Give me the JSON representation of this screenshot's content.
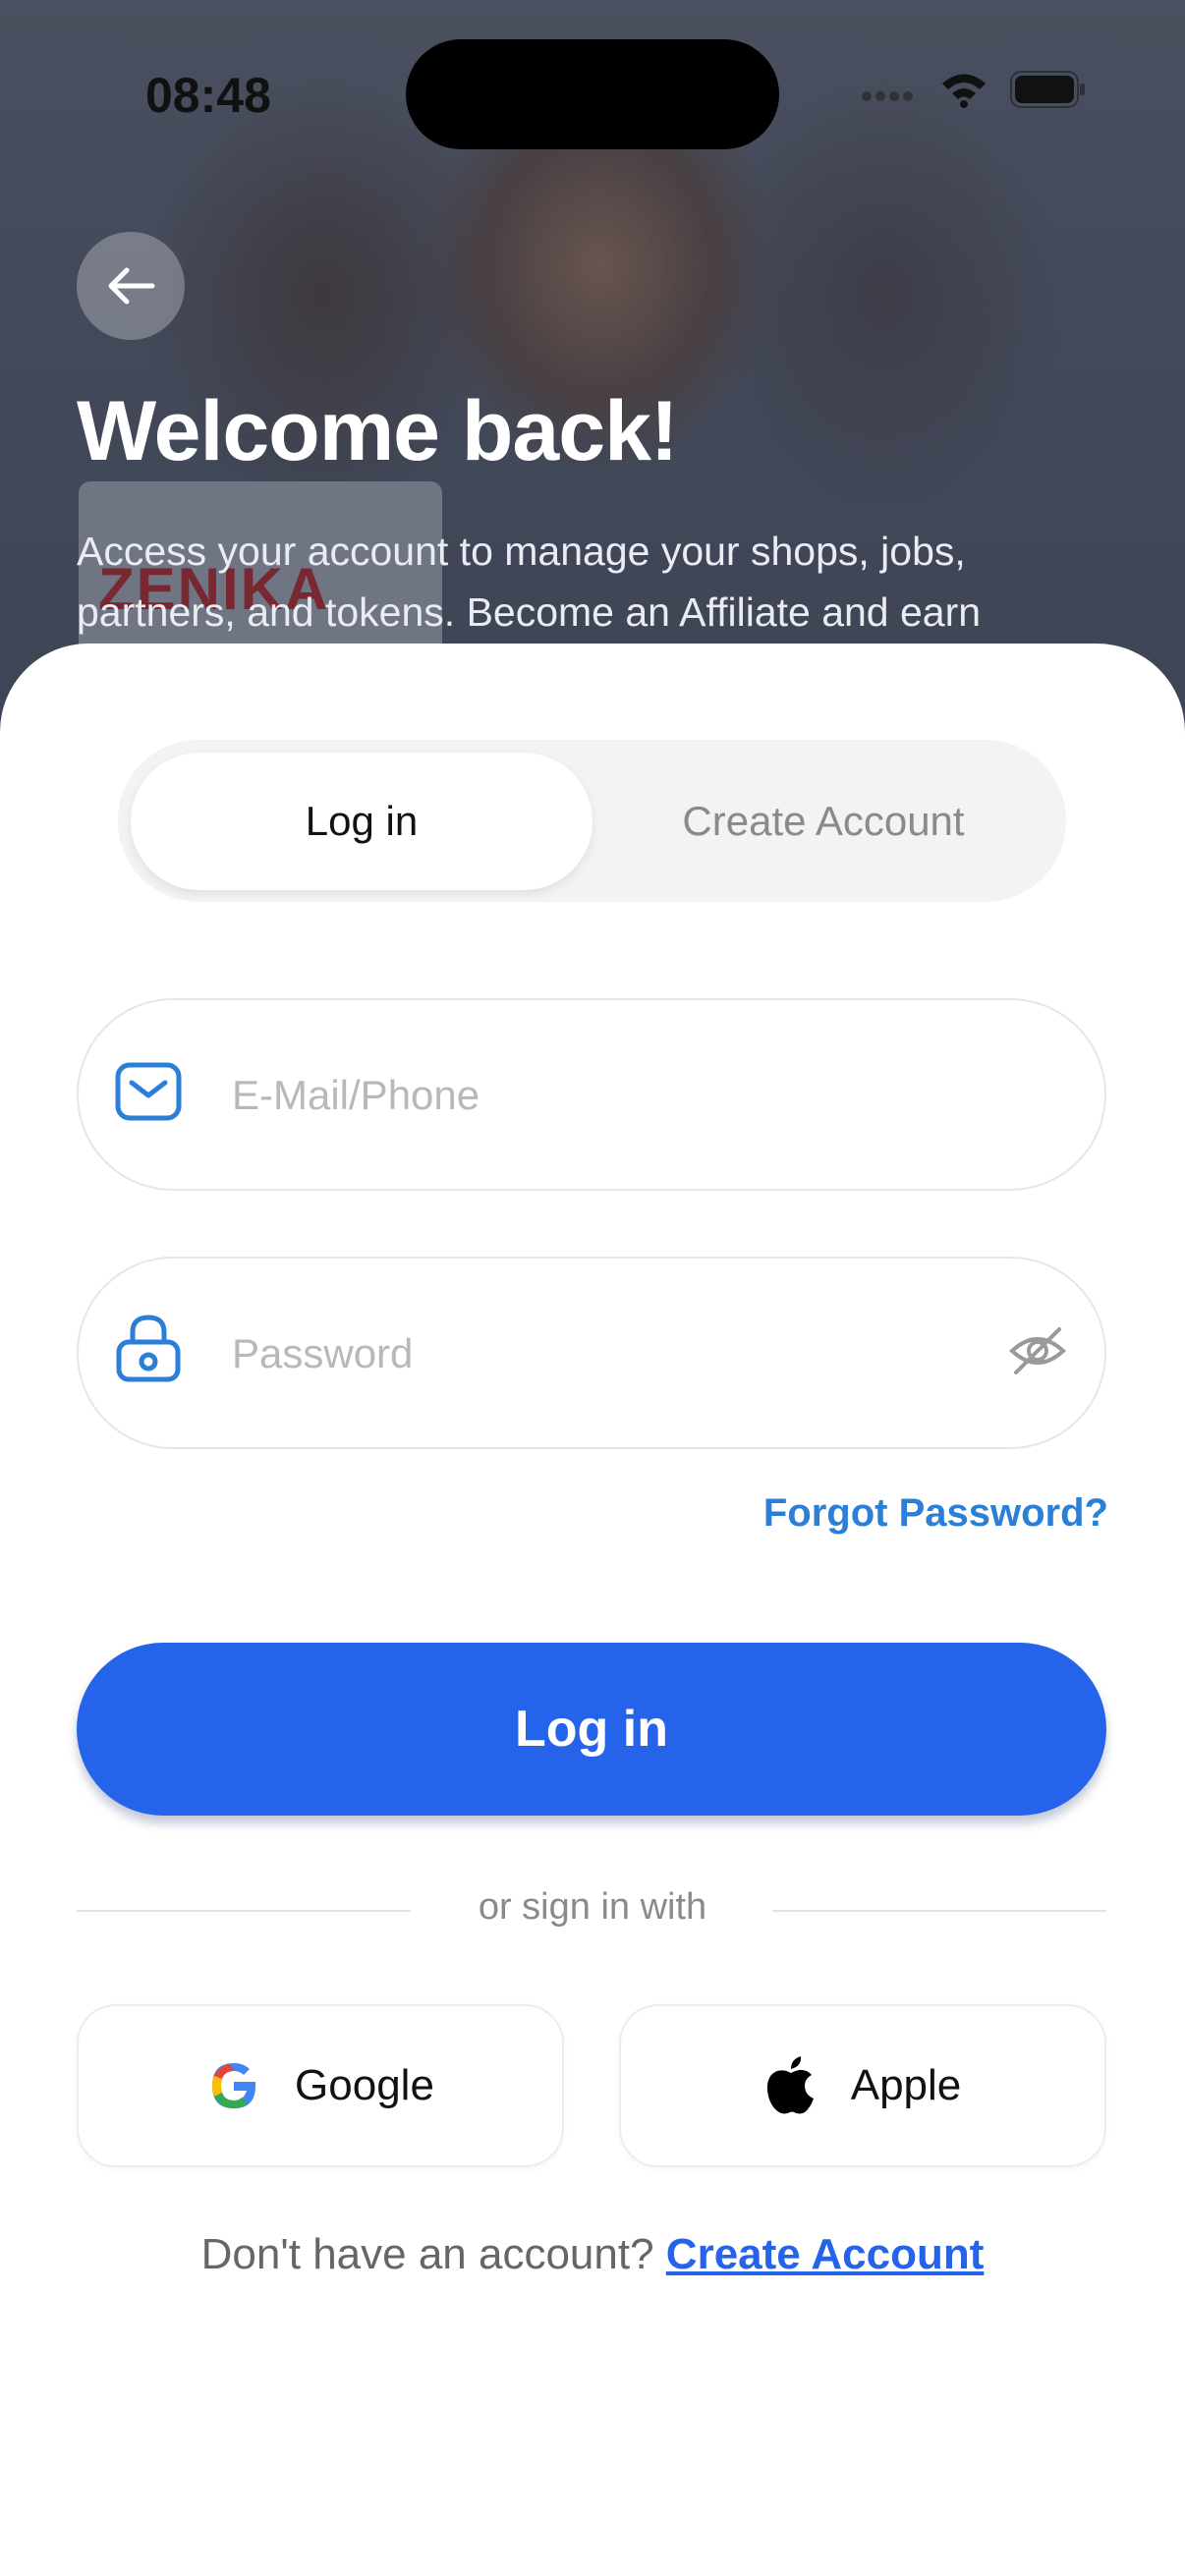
{
  "status_bar": {
    "time": "08:48"
  },
  "hero": {
    "badge_text": "ZENIKA",
    "title": "Welcome back!",
    "subtitle": "Access your account to manage your shops, jobs, partners, and tokens. Become an Affiliate and earn"
  },
  "tabs": {
    "active": "Log in",
    "inactive": "Create Account"
  },
  "form": {
    "email_placeholder": "E-Mail/Phone",
    "password_placeholder": "Password",
    "forgot_label": "Forgot Password?",
    "login_label": "Log in"
  },
  "divider_text": "or sign in with",
  "social": {
    "google_label": "Google",
    "apple_label": "Apple"
  },
  "footer": {
    "prompt": "Don't have an account? ",
    "link": "Create Account"
  },
  "colors": {
    "accent": "#2563eb",
    "link": "#2b7fd6",
    "icon": "#2b7fd6"
  }
}
